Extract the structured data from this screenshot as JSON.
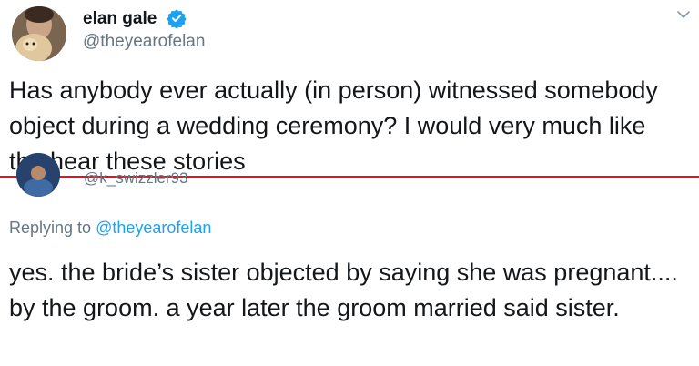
{
  "tweet": {
    "display_name": "elan gale",
    "handle": "@theyearofelan",
    "text": "Has anybody ever actually (in person) witnessed somebody object during a wedding ceremony? I would very much like the hear these stories"
  },
  "reply": {
    "handle": "@k_swizzler93",
    "replying_prefix": "Replying to ",
    "replying_to": "@theyearofelan",
    "text": "yes. the bride’s sister objected by saying she was pregnant.... by the groom. a year later the groom married said sister."
  },
  "colors": {
    "divider": "#e0161e",
    "link": "#1da1f2",
    "verified": "#1da1f2",
    "secondary_text": "#657786"
  },
  "icons": [
    "verified-badge-icon",
    "chevron-down-icon"
  ]
}
